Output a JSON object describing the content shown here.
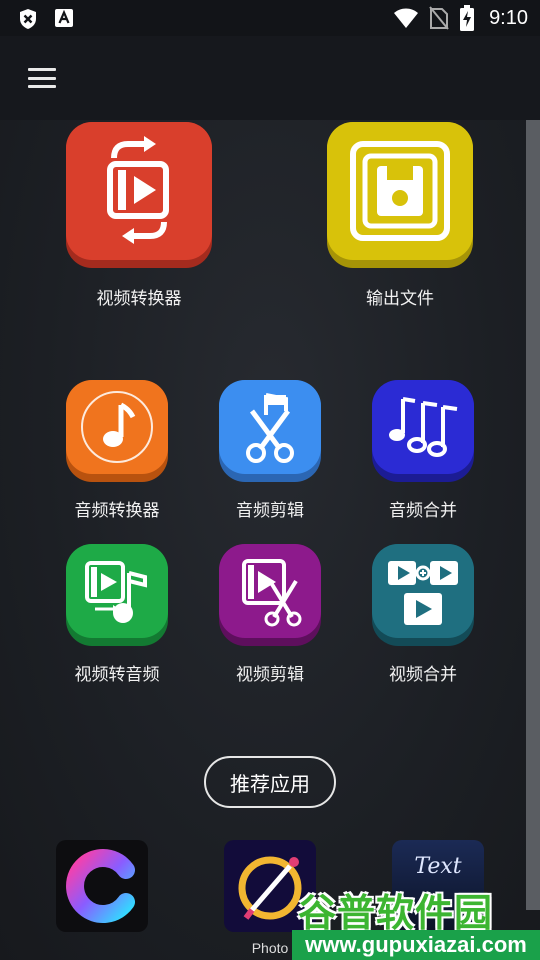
{
  "status_bar": {
    "time": "9:10"
  },
  "app_bar": {
    "menu_icon": "hamburger-menu-icon"
  },
  "tools_large": [
    {
      "label": "视频转换器",
      "icon": "video-convert-icon",
      "color": "#d93f2c"
    },
    {
      "label": "输出文件",
      "icon": "floppy-save-icon",
      "color": "#d8c20a"
    }
  ],
  "tools_small": [
    {
      "label": "音频转换器",
      "icon": "music-note-icon",
      "color": "#f0741e"
    },
    {
      "label": "音频剪辑",
      "icon": "audio-cut-icon",
      "color": "#3c8ef0"
    },
    {
      "label": "音频合并",
      "icon": "audio-merge-icon",
      "color": "#2b2bd4"
    },
    {
      "label": "视频转音频",
      "icon": "video-to-audio-icon",
      "color": "#1eaa47"
    },
    {
      "label": "视频剪辑",
      "icon": "video-cut-icon",
      "color": "#8d1a8c"
    },
    {
      "label": "视频合并",
      "icon": "video-merge-icon",
      "color": "#1f6f80"
    }
  ],
  "recommend": {
    "button_label": "推荐应用",
    "apps": [
      {
        "caption": "",
        "icon": "c-logo-app-icon"
      },
      {
        "caption": "Photo",
        "icon": "photo-editor-app-icon"
      },
      {
        "caption": "",
        "icon": "text-art-app-icon",
        "pic_text": "Text"
      }
    ]
  },
  "watermark": {
    "title": "谷普软件园",
    "url": "www.gupuxiazai.com"
  }
}
